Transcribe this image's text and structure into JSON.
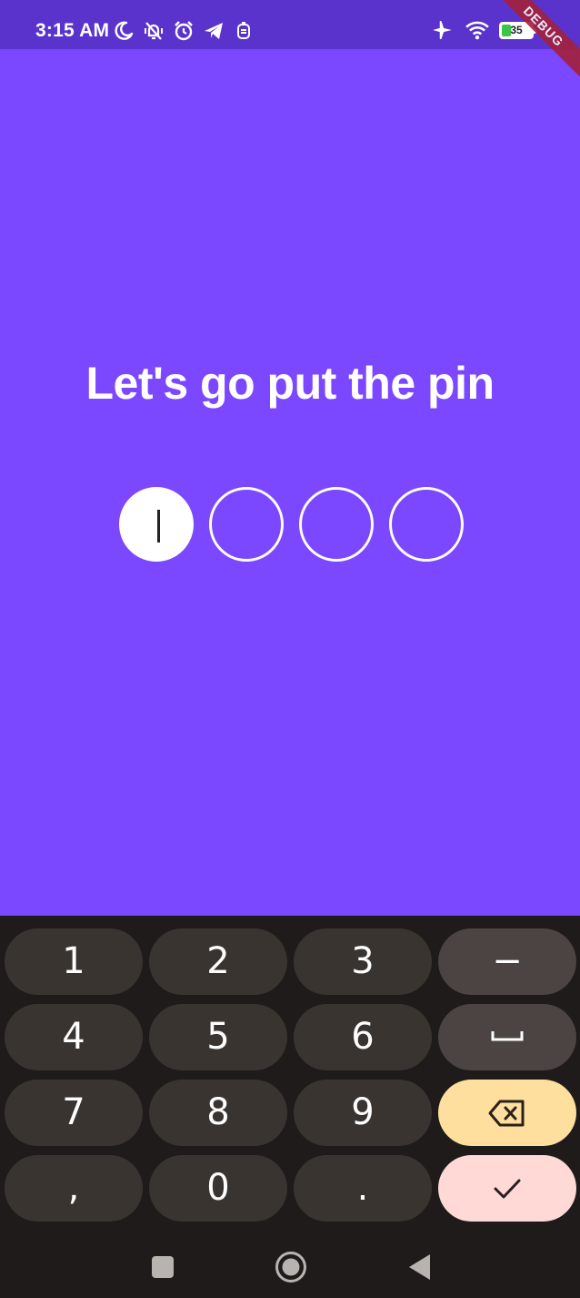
{
  "status_bar": {
    "time": "3:15 AM",
    "battery_level": "35",
    "debug_banner": "DEBUG",
    "left_icons": [
      "moon-icon",
      "vibrate-off-icon",
      "alarm-icon",
      "telegram-icon",
      "notification-icon"
    ],
    "right_icons": [
      "airplane-mode-icon",
      "wifi-icon",
      "battery-icon"
    ]
  },
  "screen": {
    "title": "Let's go put the pin",
    "background_color": "#7b47ff",
    "pin_length": 4,
    "pin_filled": 0,
    "active_index": 0
  },
  "keyboard": {
    "rows": [
      [
        "1",
        "2",
        "3",
        "−"
      ],
      [
        "4",
        "5",
        "6",
        "space"
      ],
      [
        "7",
        "8",
        "9",
        "backspace"
      ],
      [
        ",",
        "0",
        ".",
        "done"
      ]
    ],
    "labels": {
      "k1": "1",
      "k2": "2",
      "k3": "3",
      "minus": "−",
      "k4": "4",
      "k5": "5",
      "k6": "6",
      "k7": "7",
      "k8": "8",
      "k9": "9",
      "comma": ",",
      "k0": "0",
      "period": "."
    },
    "colors": {
      "key": "#3a3431",
      "function_key": "#4b4442",
      "backspace_key": "#ffdf9e",
      "done_key": "#ffd9d6"
    }
  },
  "nav_bar": {
    "buttons": [
      "recents-square-icon",
      "home-circle-icon",
      "back-triangle-icon"
    ]
  }
}
